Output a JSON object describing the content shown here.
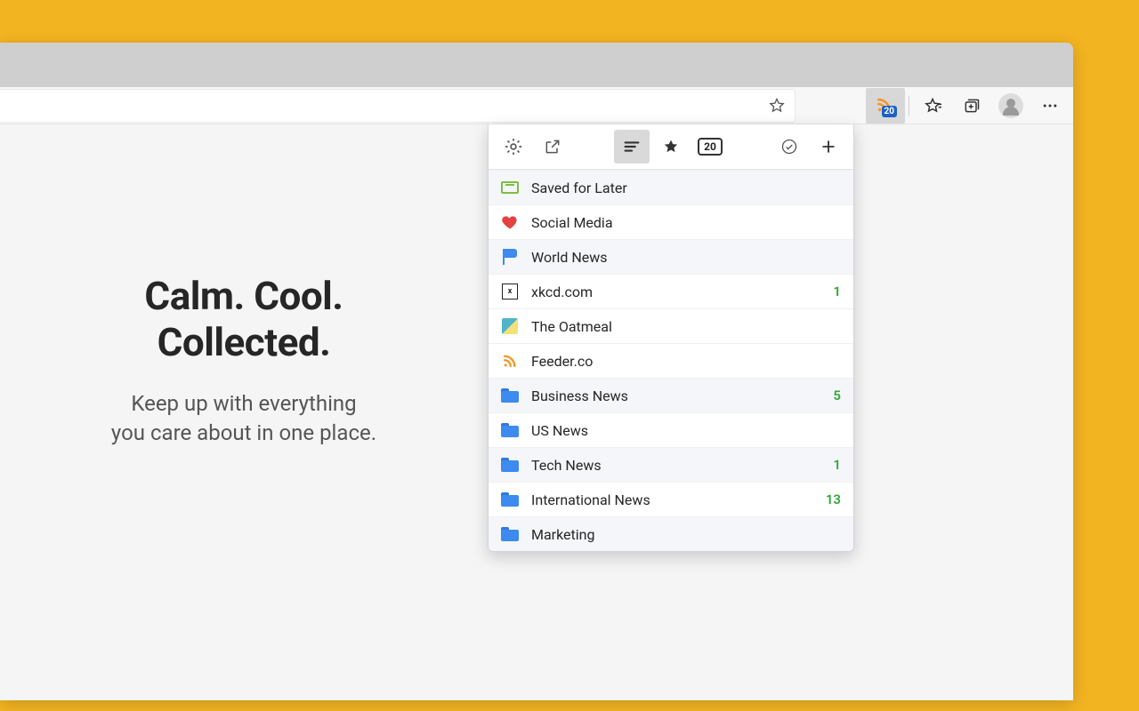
{
  "hero": {
    "title_line1": "Calm. Cool.",
    "title_line2": "Collected.",
    "subtitle_line1": "Keep up with everything",
    "subtitle_line2": "you care about in one place."
  },
  "extension_badge_count": "20",
  "popover": {
    "unread_total": "20",
    "items": [
      {
        "label": "Saved for Later",
        "count": "",
        "icon": "inbox",
        "alt": true
      },
      {
        "label": "Social Media",
        "count": "",
        "icon": "heart",
        "alt": false
      },
      {
        "label": "World News",
        "count": "",
        "icon": "flag",
        "alt": true
      },
      {
        "label": "xkcd.com",
        "count": "1",
        "icon": "xkcd",
        "alt": false
      },
      {
        "label": "The Oatmeal",
        "count": "",
        "icon": "oatmeal",
        "alt": false
      },
      {
        "label": "Feeder.co",
        "count": "",
        "icon": "rss",
        "alt": false
      },
      {
        "label": "Business News",
        "count": "5",
        "icon": "folder",
        "alt": true
      },
      {
        "label": "US News",
        "count": "",
        "icon": "folder",
        "alt": false
      },
      {
        "label": "Tech News",
        "count": "1",
        "icon": "folder",
        "alt": true
      },
      {
        "label": "International News",
        "count": "13",
        "icon": "folder",
        "alt": false
      },
      {
        "label": "Marketing",
        "count": "",
        "icon": "folder",
        "alt": true
      }
    ]
  }
}
